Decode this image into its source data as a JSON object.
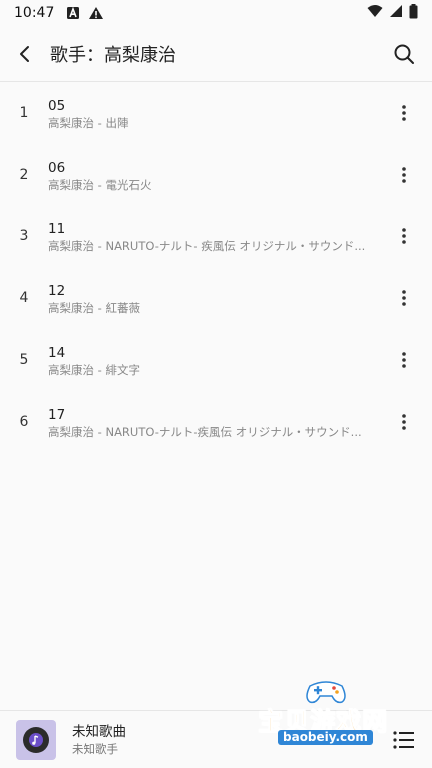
{
  "status": {
    "time": "10:47"
  },
  "header": {
    "title": "歌手：高梨康治"
  },
  "tracks": [
    {
      "index": "1",
      "name": "05",
      "subtitle": "高梨康治 - 出陣"
    },
    {
      "index": "2",
      "name": "06",
      "subtitle": "高梨康治 - 電光石火"
    },
    {
      "index": "3",
      "name": "11",
      "subtitle": "高梨康治 - NARUTO-ナルト- 疾風伝 オリジナル・サウンド..."
    },
    {
      "index": "4",
      "name": "12",
      "subtitle": "高梨康治 - 紅蕃薇"
    },
    {
      "index": "5",
      "name": "14",
      "subtitle": "高梨康治 - 緋文字"
    },
    {
      "index": "6",
      "name": "17",
      "subtitle": "高梨康治 - NARUTO-ナルト-疾風伝 オリジナル・サウンド..."
    }
  ],
  "player": {
    "song": "未知歌曲",
    "artist": "未知歌手"
  },
  "watermark": {
    "text": "宝贝游戏网",
    "url": "baobeiy.com"
  },
  "colors": {
    "accent": "#6b4fc9",
    "cover_bg": "#c9c2e8",
    "watermark": "#f4a321"
  }
}
